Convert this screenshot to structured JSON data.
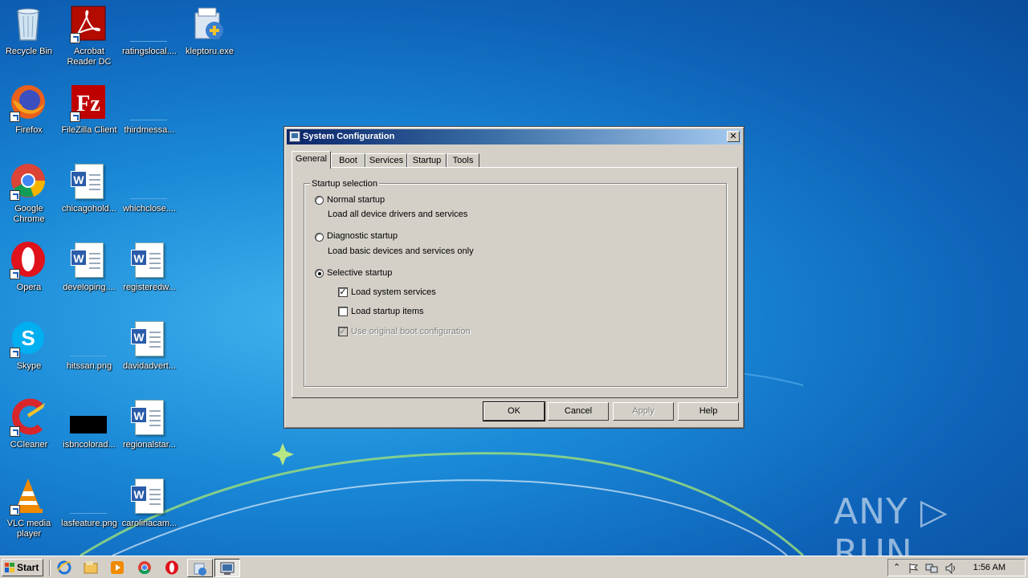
{
  "desktop": {
    "icons": [
      {
        "label": "Recycle Bin",
        "icon": "recycle-bin-icon"
      },
      {
        "label": "Acrobat Reader DC",
        "icon": "acrobat-icon"
      },
      {
        "label": "ratingslocal....",
        "icon": "blank-file-icon"
      },
      {
        "label": "kleptoru.exe",
        "icon": "installer-icon"
      },
      {
        "label": "Firefox",
        "icon": "firefox-icon"
      },
      {
        "label": "FileZilla Client",
        "icon": "filezilla-icon"
      },
      {
        "label": "thirdmessa...",
        "icon": "blank-file-icon"
      },
      {
        "label": "Google Chrome",
        "icon": "chrome-icon"
      },
      {
        "label": "chicagohold...",
        "icon": "word-doc-icon"
      },
      {
        "label": "whichclose....",
        "icon": "blank-file-icon"
      },
      {
        "label": "Opera",
        "icon": "opera-icon"
      },
      {
        "label": "developing....",
        "icon": "word-doc-icon"
      },
      {
        "label": "registeredw...",
        "icon": "word-doc-icon"
      },
      {
        "label": "Skype",
        "icon": "skype-icon"
      },
      {
        "label": "hitssan.png",
        "icon": "image-file-icon"
      },
      {
        "label": "davidadvert...",
        "icon": "word-doc-icon"
      },
      {
        "label": "CCleaner",
        "icon": "ccleaner-icon"
      },
      {
        "label": "isbncolorad...",
        "icon": "image-file-icon"
      },
      {
        "label": "regionalstar...",
        "icon": "word-doc-icon"
      },
      {
        "label": "VLC media player",
        "icon": "vlc-icon"
      },
      {
        "label": "lasfeature.png",
        "icon": "image-file-icon"
      },
      {
        "label": "carolinacam...",
        "icon": "word-doc-icon"
      }
    ]
  },
  "dialog": {
    "title": "System Configuration",
    "close": "✕",
    "tabs": [
      "General",
      "Boot",
      "Services",
      "Startup",
      "Tools"
    ],
    "active_tab": "General",
    "group_title": "Startup selection",
    "options": {
      "normal": {
        "label": "Normal startup",
        "desc": "Load all device drivers and services",
        "selected": false
      },
      "diagnostic": {
        "label": "Diagnostic startup",
        "desc": "Load basic devices and services only",
        "selected": false
      },
      "selective": {
        "label": "Selective startup",
        "selected": true
      }
    },
    "checks": {
      "system_services": {
        "label": "Load system services",
        "checked": true
      },
      "startup_items": {
        "label": "Load startup items",
        "checked": false
      },
      "original_boot": {
        "label": "Use original boot configuration",
        "checked": true,
        "disabled": true
      }
    },
    "buttons": {
      "ok": "OK",
      "cancel": "Cancel",
      "apply": "Apply",
      "help": "Help"
    }
  },
  "taskbar": {
    "start_label": "Start",
    "clock": "1:56 AM",
    "tray_expand": "⌃"
  },
  "watermark": "ANY ▷ RUN"
}
